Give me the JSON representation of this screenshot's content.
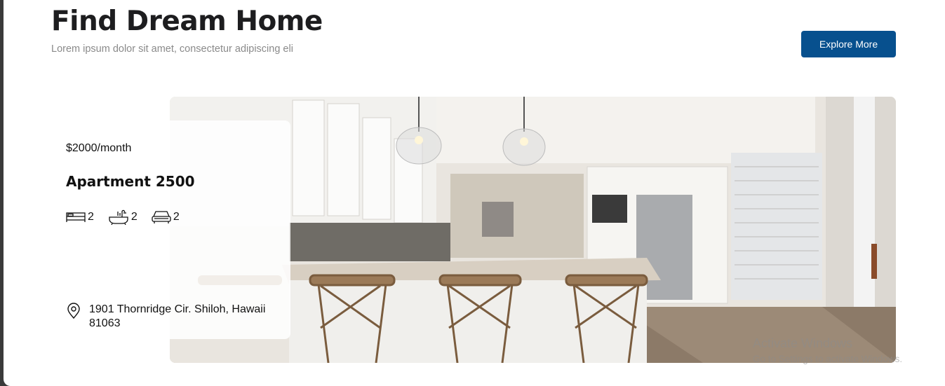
{
  "header": {
    "title": "Find Dream Home",
    "subtitle": "Lorem ipsum dolor sit amet, consectetur adipiscing eli",
    "explore_button": "Explore More"
  },
  "listing": {
    "price": "$2000/month",
    "name": "Apartment 2500",
    "features": [
      {
        "icon": "bed-icon",
        "value": "2"
      },
      {
        "icon": "bathtub-icon",
        "value": "2"
      },
      {
        "icon": "car-icon",
        "value": "2"
      }
    ],
    "address": "1901 Thornridge Cir. Shiloh, Hawaii 81063",
    "image_alt": "kitchen-photo"
  },
  "watermark": {
    "line1": "Activate Windows",
    "line2": "Go to Settings to activate Windows."
  },
  "colors": {
    "accent": "#07508e",
    "text": "#1d1d1f",
    "muted": "#8a8a8a"
  }
}
